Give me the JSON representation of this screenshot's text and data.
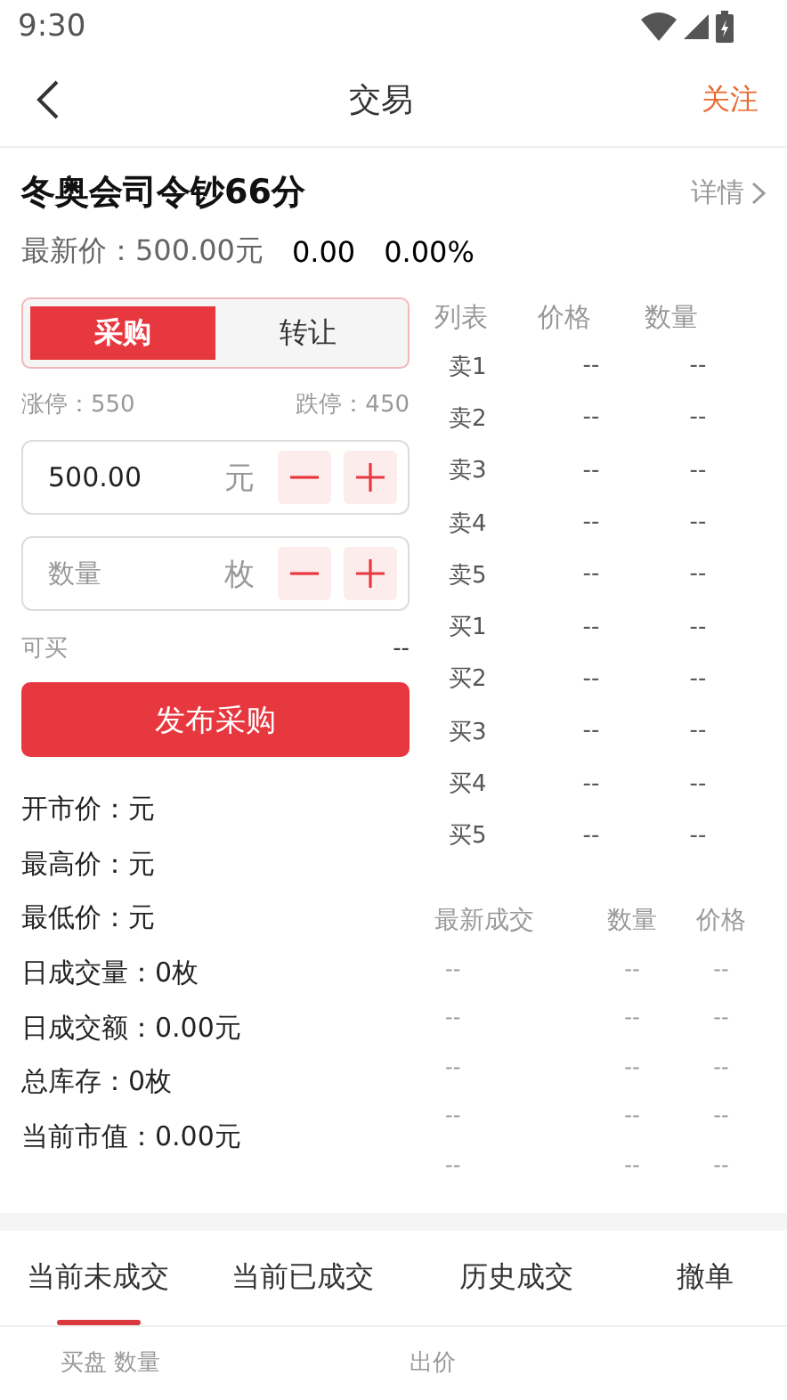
{
  "status_bar": {
    "time": "9:30"
  },
  "header": {
    "title": "交易",
    "action": "关注"
  },
  "product": {
    "name": "冬奥会司令钞66分",
    "detail_link": "详情"
  },
  "price": {
    "label": "最新价：",
    "value": "500.00元",
    "change": "0.00",
    "change_pct": "0.00%"
  },
  "mode_tabs": [
    {
      "label": "采购",
      "selected": true
    },
    {
      "label": "转让",
      "selected": false
    }
  ],
  "limits": {
    "up": "涨停：550",
    "down": "跌停：450"
  },
  "price_input": {
    "value": "500.00",
    "unit": "元"
  },
  "quantity_input": {
    "placeholder": "数量",
    "unit": "枚"
  },
  "available": {
    "label": "可买",
    "value": "--"
  },
  "submit_button": "发布采购",
  "stats": [
    "开市价：元",
    "最高价：元",
    "最低价：元",
    "日成交量：0枚",
    "日成交额：0.00元",
    "总库存：0枚",
    "当前市值：0.00元"
  ],
  "order_book": {
    "columns": [
      "列表",
      "价格",
      "数量"
    ],
    "rows": [
      {
        "label": "卖1",
        "price": "--",
        "quantity": "--"
      },
      {
        "label": "卖2",
        "price": "--",
        "quantity": "--"
      },
      {
        "label": "卖3",
        "price": "--",
        "quantity": "--"
      },
      {
        "label": "卖4",
        "price": "--",
        "quantity": "--"
      },
      {
        "label": "卖5",
        "price": "--",
        "quantity": "--"
      },
      {
        "label": "买1",
        "price": "--",
        "quantity": "--"
      },
      {
        "label": "买2",
        "price": "--",
        "quantity": "--"
      },
      {
        "label": "买3",
        "price": "--",
        "quantity": "--"
      },
      {
        "label": "买4",
        "price": "--",
        "quantity": "--"
      },
      {
        "label": "买5",
        "price": "--",
        "quantity": "--"
      }
    ]
  },
  "trades": {
    "columns": [
      "最新成交",
      "数量",
      "价格"
    ],
    "rows": [
      {
        "time": "--",
        "quantity": "--",
        "price": "--"
      },
      {
        "time": "--",
        "quantity": "--",
        "price": "--"
      },
      {
        "time": "--",
        "quantity": "--",
        "price": "--"
      },
      {
        "time": "--",
        "quantity": "--",
        "price": "--"
      },
      {
        "time": "--",
        "quantity": "--",
        "price": "--"
      }
    ]
  },
  "bottom_tabs": [
    {
      "label": "当前未成交",
      "selected": true
    },
    {
      "label": "当前已成交",
      "selected": false
    },
    {
      "label": "历史成交",
      "selected": false
    },
    {
      "label": "撤单",
      "selected": false
    }
  ],
  "list_header": [
    "买盘",
    "数量",
    "出价"
  ]
}
